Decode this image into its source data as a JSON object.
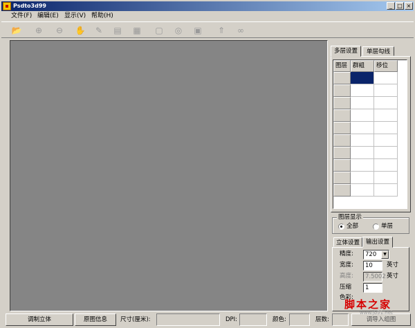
{
  "window": {
    "title": "Psdto3d99"
  },
  "title_buttons": {
    "minimize": "_",
    "maximize": "□",
    "close": "×"
  },
  "menu": [
    "文件(F)",
    "编辑(E)",
    "显示(V)",
    "帮助(H)"
  ],
  "toolbar": [
    {
      "icon": "open-folder-icon",
      "glyph": "📂"
    },
    {
      "icon": "zoom-in-icon",
      "glyph": "⊕"
    },
    {
      "icon": "zoom-out-icon",
      "glyph": "⊖"
    },
    {
      "icon": "hand-tool-icon",
      "glyph": "✋"
    },
    {
      "icon": "pencil-icon",
      "glyph": "✎"
    },
    {
      "icon": "document-icon",
      "glyph": "▤"
    },
    {
      "icon": "layers-icon",
      "glyph": "▦"
    },
    {
      "icon": "frame-icon",
      "glyph": "▢"
    },
    {
      "icon": "target-icon",
      "glyph": "◎"
    },
    {
      "icon": "edit-box-icon",
      "glyph": "▣"
    },
    {
      "icon": "arrow-up-icon",
      "glyph": "⇑"
    },
    {
      "icon": "link-icon",
      "glyph": "∞"
    }
  ],
  "panel": {
    "tabs": [
      "多层设置",
      "单层勾线"
    ],
    "grid_headers": [
      "图层",
      "群組",
      "移位"
    ],
    "row_count": 10,
    "layer_display": {
      "title": "图层显示",
      "options": [
        "全部",
        "单层"
      ],
      "selected": "全部"
    },
    "output_tabs": [
      "立体设置",
      "输出设置"
    ],
    "output": {
      "precision_label": "精度:",
      "precision_value": "720",
      "width_label": "宽度:",
      "width_value": "10",
      "width_unit": "英寸",
      "height_label": "高度:",
      "height_value": "7.5002",
      "height_unit": "英寸",
      "compress_label": "压缩",
      "compress_value": "1",
      "color_label": "色彩:"
    }
  },
  "statusbar": {
    "button1": "调制立体",
    "button2": "原图信息",
    "size_label": "尺寸(厘米):",
    "dpi_label": "DPI:",
    "color_label": "颜色:",
    "layers_label": "层数:",
    "right_text": "调导入组图"
  },
  "watermark": {
    "text": "脚本之家",
    "sub": "www.jb51.net"
  }
}
